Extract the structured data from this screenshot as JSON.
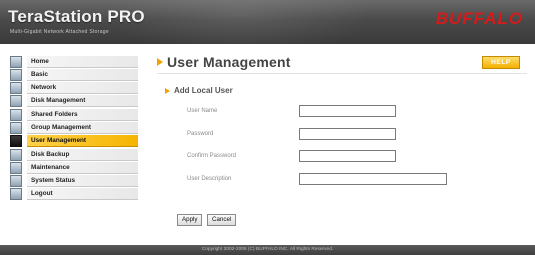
{
  "header": {
    "title": "TeraStation PRO",
    "subtitle": "Multi-Gigabit Network Attached Storage",
    "logo": "BUFFALO",
    "logo_color": "#d41a1a"
  },
  "sidebar": {
    "items": [
      {
        "label": "Home",
        "icon": "home-icon",
        "active": false
      },
      {
        "label": "Basic",
        "icon": "basic-settings-icon",
        "active": false
      },
      {
        "label": "Network",
        "icon": "network-icon",
        "active": false
      },
      {
        "label": "Disk Management",
        "icon": "disk-management-icon",
        "active": false
      },
      {
        "label": "Shared Folders",
        "icon": "shared-folders-icon",
        "active": false
      },
      {
        "label": "Group Management",
        "icon": "group-icon",
        "active": false
      },
      {
        "label": "User Management",
        "icon": "user-icon",
        "active": true
      },
      {
        "label": "Disk Backup",
        "icon": "backup-icon",
        "active": false
      },
      {
        "label": "Maintenance",
        "icon": "maintenance-icon",
        "active": false
      },
      {
        "label": "System Status",
        "icon": "status-icon",
        "active": false
      },
      {
        "label": "Logout",
        "icon": "logout-icon",
        "active": false
      }
    ],
    "active_color": "#f5b400"
  },
  "main": {
    "title": "User Management",
    "help_label": "HELP",
    "section_title": "Add Local User",
    "fields": [
      {
        "label": "User Name",
        "value": ""
      },
      {
        "label": "Password",
        "value": ""
      },
      {
        "label": "Confirm Password",
        "value": ""
      },
      {
        "label": "User Description",
        "value": ""
      }
    ],
    "apply_label": "Apply",
    "cancel_label": "Cancel",
    "accent_color": "#f4a100"
  },
  "footer": {
    "copyright": "Copyright 2002-2006 (C) BUFFALO INC. All Rights Reserved."
  }
}
